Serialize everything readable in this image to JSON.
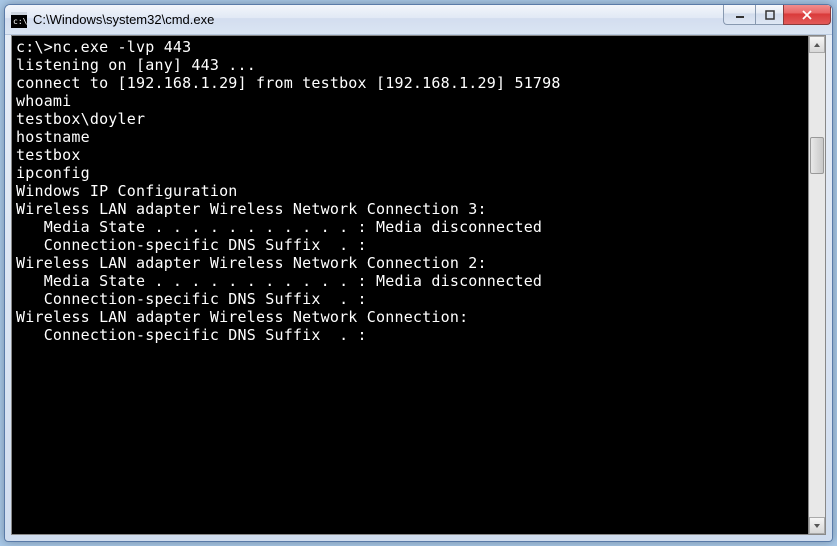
{
  "window": {
    "title": "C:\\Windows\\system32\\cmd.exe"
  },
  "scrollbar": {
    "thumb_top_pct": 18,
    "thumb_height_pct": 8
  },
  "terminal": {
    "lines": [
      "c:\\>nc.exe -lvp 443",
      "listening on [any] 443 ...",
      "connect to [192.168.1.29] from testbox [192.168.1.29] 51798",
      "whoami",
      "testbox\\doyler",
      "hostname",
      "testbox",
      "ipconfig",
      "",
      "Windows IP Configuration",
      "",
      "",
      "Wireless LAN adapter Wireless Network Connection 3:",
      "",
      "   Media State . . . . . . . . . . . : Media disconnected",
      "   Connection-specific DNS Suffix  . :",
      "",
      "Wireless LAN adapter Wireless Network Connection 2:",
      "",
      "   Media State . . . . . . . . . . . : Media disconnected",
      "   Connection-specific DNS Suffix  . :",
      "",
      "Wireless LAN adapter Wireless Network Connection:",
      "",
      "   Connection-specific DNS Suffix  . :"
    ]
  }
}
